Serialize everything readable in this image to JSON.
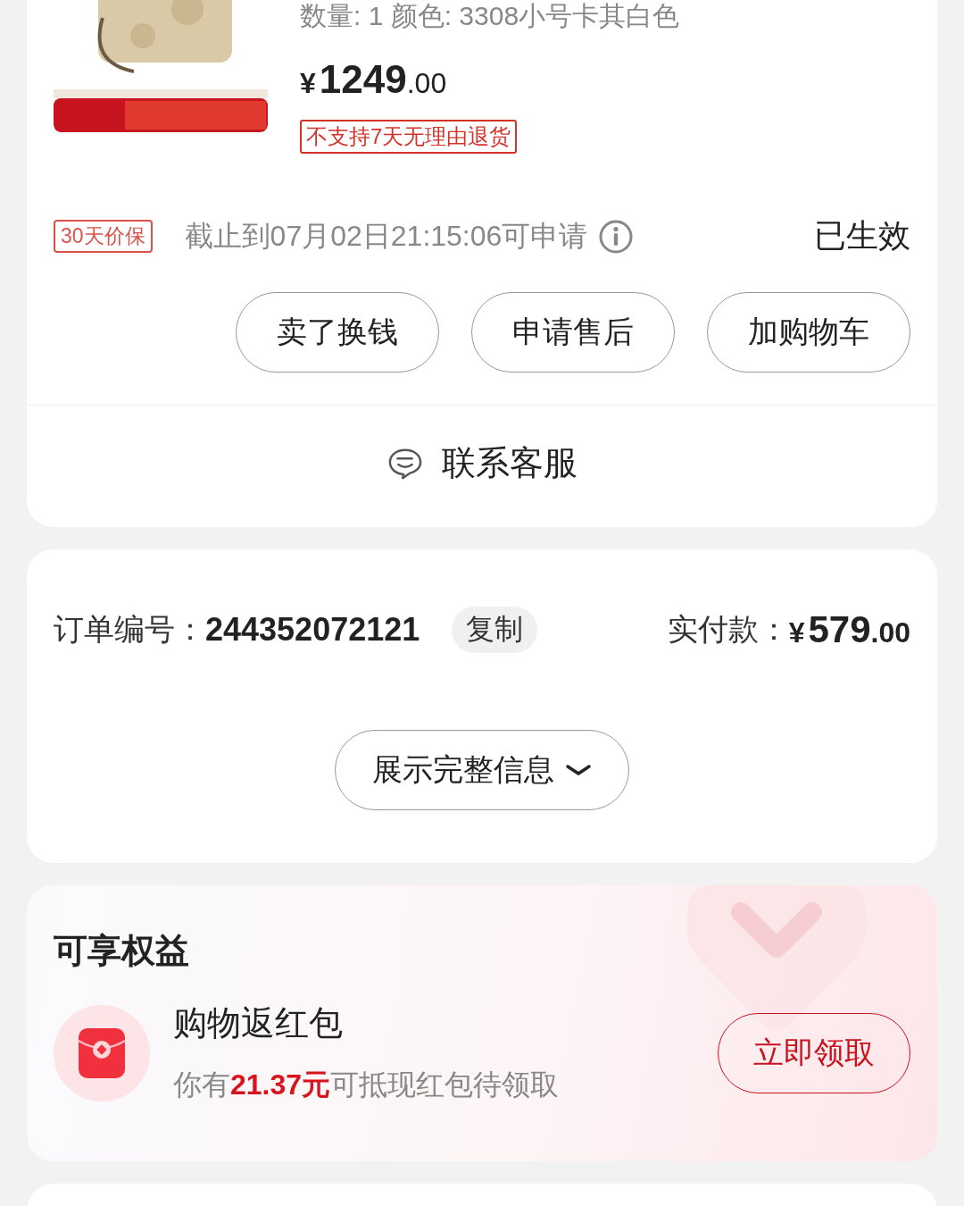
{
  "product": {
    "specs": "数量: 1  颜色: 3308小号卡其白色",
    "price": {
      "symbol": "¥",
      "integer": "1249",
      "decimal": ".00"
    },
    "tag": "不支持7天无理由退货"
  },
  "price_protect": {
    "badge": "30天价保",
    "deadline": "截止到07月02日21:15:06可申请",
    "status": "已生效"
  },
  "actions": [
    {
      "label": "卖了换钱"
    },
    {
      "label": "申请售后"
    },
    {
      "label": "加购物车"
    }
  ],
  "customer_service": {
    "label": "联系客服"
  },
  "order": {
    "number_label": "订单编号：",
    "number": "244352072121",
    "copy_button": "复制",
    "paid_label": "实付款：",
    "paid": {
      "symbol": "¥",
      "integer": "579",
      "decimal": ".00"
    },
    "expand_button": "展示完整信息"
  },
  "benefits": {
    "title": "可享权益",
    "items": [
      {
        "title": "购物返红包",
        "description": [
          {
            "kind": "plain",
            "text": "你有"
          },
          {
            "kind": "highlight",
            "text": "21.37元"
          },
          {
            "kind": "plain",
            "text": "可抵现红包待领取"
          }
        ],
        "button": "立即领取"
      }
    ]
  }
}
